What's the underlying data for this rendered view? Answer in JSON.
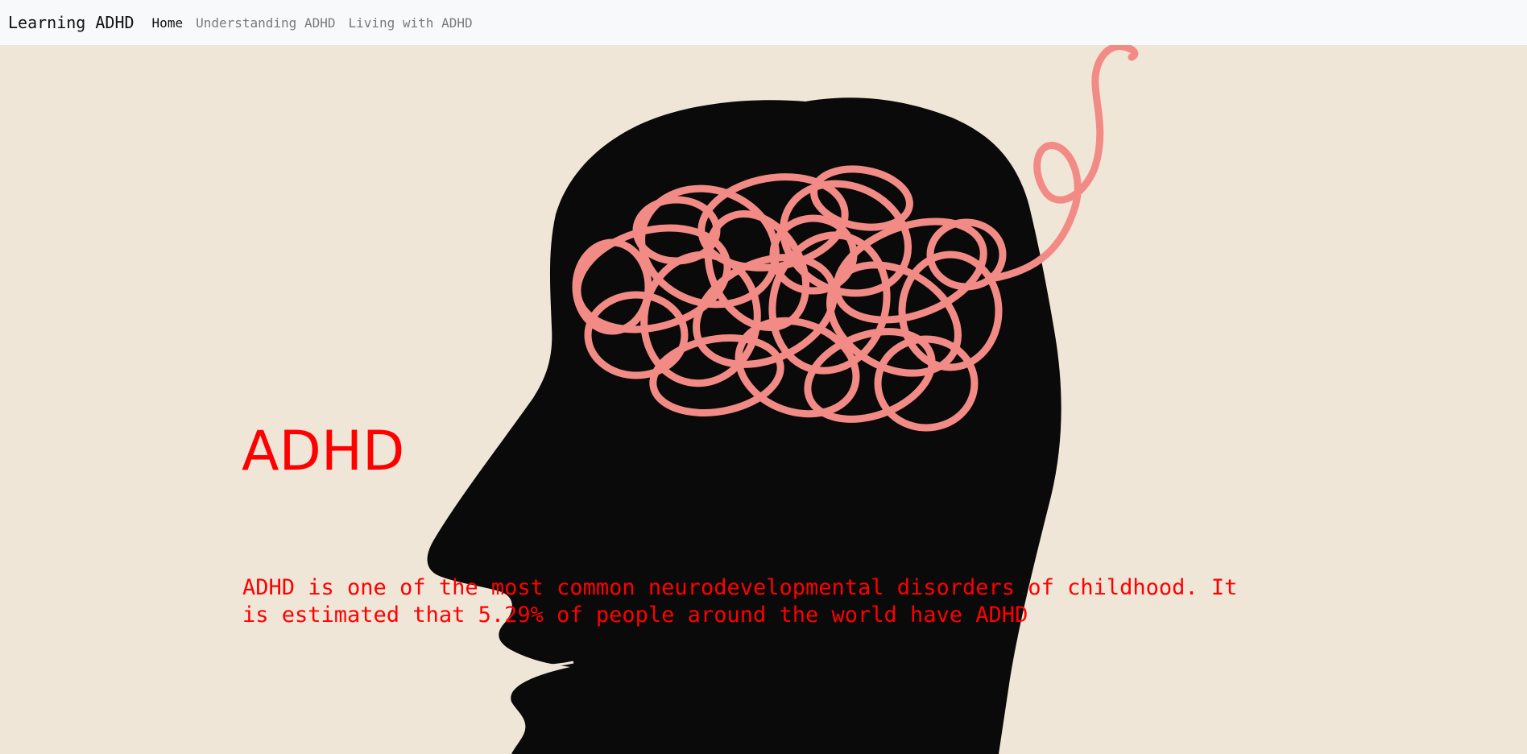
{
  "navbar": {
    "brand": "Learning ADHD",
    "links": [
      {
        "label": "Home",
        "active": true
      },
      {
        "label": "Understanding ADHD",
        "active": false
      },
      {
        "label": "Living with ADHD",
        "active": false
      }
    ]
  },
  "hero": {
    "title": "ADHD",
    "text_line_1": "ADHD is one of the most common neurodevelopmental disorders of childhood. It",
    "text_line_2": "is estimated that 5.29% of people around the world have ADHD",
    "image_icon": "head-silhouette-with-tangled-brain"
  },
  "colors": {
    "nav_background": "#f8f9fa",
    "hero_background": "#f0e6d7",
    "silhouette": "#0a0a0a",
    "tangle": "#f28b85",
    "heading_text": "#ff0000"
  }
}
